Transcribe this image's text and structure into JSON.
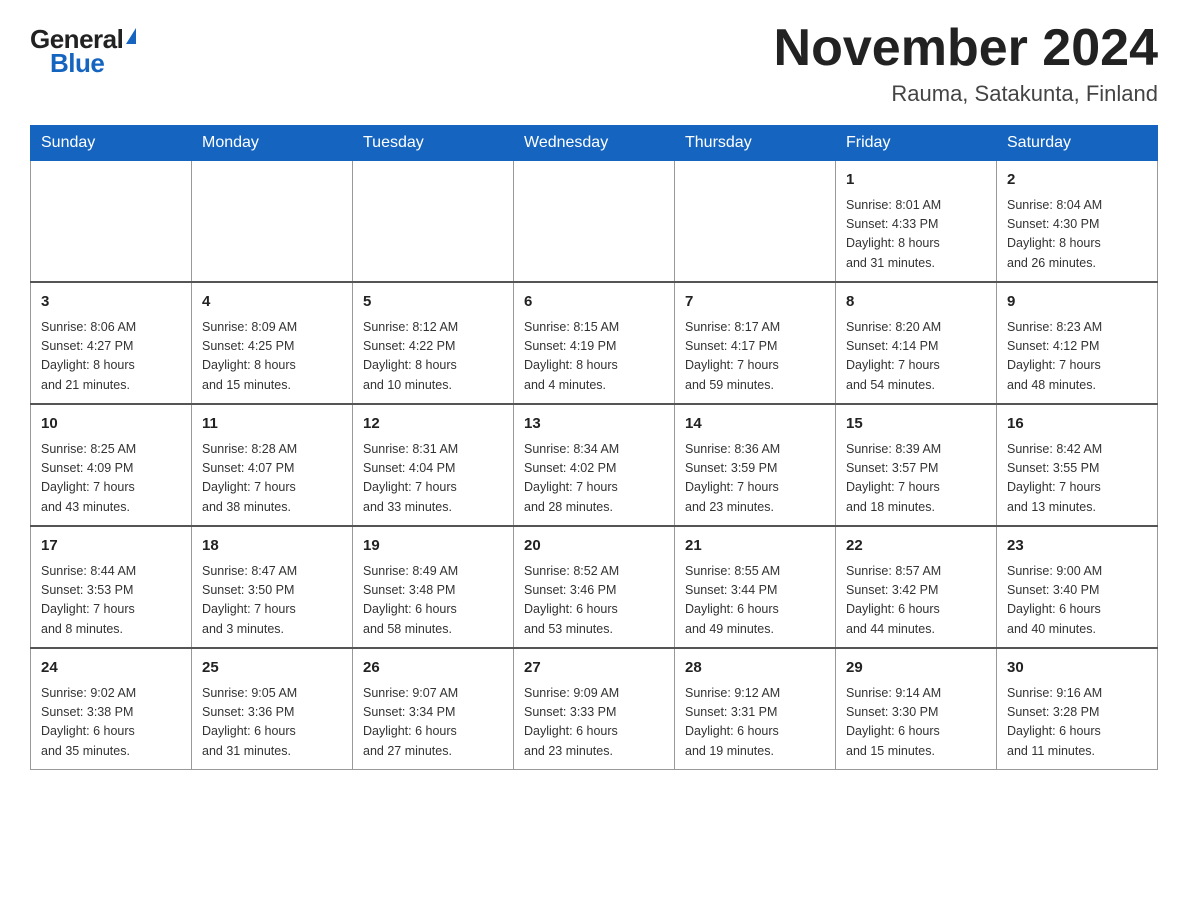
{
  "logo": {
    "general": "General",
    "blue": "Blue"
  },
  "title": "November 2024",
  "location": "Rauma, Satakunta, Finland",
  "days_of_week": [
    "Sunday",
    "Monday",
    "Tuesday",
    "Wednesday",
    "Thursday",
    "Friday",
    "Saturday"
  ],
  "weeks": [
    [
      {
        "day": "",
        "info": ""
      },
      {
        "day": "",
        "info": ""
      },
      {
        "day": "",
        "info": ""
      },
      {
        "day": "",
        "info": ""
      },
      {
        "day": "",
        "info": ""
      },
      {
        "day": "1",
        "info": "Sunrise: 8:01 AM\nSunset: 4:33 PM\nDaylight: 8 hours\nand 31 minutes."
      },
      {
        "day": "2",
        "info": "Sunrise: 8:04 AM\nSunset: 4:30 PM\nDaylight: 8 hours\nand 26 minutes."
      }
    ],
    [
      {
        "day": "3",
        "info": "Sunrise: 8:06 AM\nSunset: 4:27 PM\nDaylight: 8 hours\nand 21 minutes."
      },
      {
        "day": "4",
        "info": "Sunrise: 8:09 AM\nSunset: 4:25 PM\nDaylight: 8 hours\nand 15 minutes."
      },
      {
        "day": "5",
        "info": "Sunrise: 8:12 AM\nSunset: 4:22 PM\nDaylight: 8 hours\nand 10 minutes."
      },
      {
        "day": "6",
        "info": "Sunrise: 8:15 AM\nSunset: 4:19 PM\nDaylight: 8 hours\nand 4 minutes."
      },
      {
        "day": "7",
        "info": "Sunrise: 8:17 AM\nSunset: 4:17 PM\nDaylight: 7 hours\nand 59 minutes."
      },
      {
        "day": "8",
        "info": "Sunrise: 8:20 AM\nSunset: 4:14 PM\nDaylight: 7 hours\nand 54 minutes."
      },
      {
        "day": "9",
        "info": "Sunrise: 8:23 AM\nSunset: 4:12 PM\nDaylight: 7 hours\nand 48 minutes."
      }
    ],
    [
      {
        "day": "10",
        "info": "Sunrise: 8:25 AM\nSunset: 4:09 PM\nDaylight: 7 hours\nand 43 minutes."
      },
      {
        "day": "11",
        "info": "Sunrise: 8:28 AM\nSunset: 4:07 PM\nDaylight: 7 hours\nand 38 minutes."
      },
      {
        "day": "12",
        "info": "Sunrise: 8:31 AM\nSunset: 4:04 PM\nDaylight: 7 hours\nand 33 minutes."
      },
      {
        "day": "13",
        "info": "Sunrise: 8:34 AM\nSunset: 4:02 PM\nDaylight: 7 hours\nand 28 minutes."
      },
      {
        "day": "14",
        "info": "Sunrise: 8:36 AM\nSunset: 3:59 PM\nDaylight: 7 hours\nand 23 minutes."
      },
      {
        "day": "15",
        "info": "Sunrise: 8:39 AM\nSunset: 3:57 PM\nDaylight: 7 hours\nand 18 minutes."
      },
      {
        "day": "16",
        "info": "Sunrise: 8:42 AM\nSunset: 3:55 PM\nDaylight: 7 hours\nand 13 minutes."
      }
    ],
    [
      {
        "day": "17",
        "info": "Sunrise: 8:44 AM\nSunset: 3:53 PM\nDaylight: 7 hours\nand 8 minutes."
      },
      {
        "day": "18",
        "info": "Sunrise: 8:47 AM\nSunset: 3:50 PM\nDaylight: 7 hours\nand 3 minutes."
      },
      {
        "day": "19",
        "info": "Sunrise: 8:49 AM\nSunset: 3:48 PM\nDaylight: 6 hours\nand 58 minutes."
      },
      {
        "day": "20",
        "info": "Sunrise: 8:52 AM\nSunset: 3:46 PM\nDaylight: 6 hours\nand 53 minutes."
      },
      {
        "day": "21",
        "info": "Sunrise: 8:55 AM\nSunset: 3:44 PM\nDaylight: 6 hours\nand 49 minutes."
      },
      {
        "day": "22",
        "info": "Sunrise: 8:57 AM\nSunset: 3:42 PM\nDaylight: 6 hours\nand 44 minutes."
      },
      {
        "day": "23",
        "info": "Sunrise: 9:00 AM\nSunset: 3:40 PM\nDaylight: 6 hours\nand 40 minutes."
      }
    ],
    [
      {
        "day": "24",
        "info": "Sunrise: 9:02 AM\nSunset: 3:38 PM\nDaylight: 6 hours\nand 35 minutes."
      },
      {
        "day": "25",
        "info": "Sunrise: 9:05 AM\nSunset: 3:36 PM\nDaylight: 6 hours\nand 31 minutes."
      },
      {
        "day": "26",
        "info": "Sunrise: 9:07 AM\nSunset: 3:34 PM\nDaylight: 6 hours\nand 27 minutes."
      },
      {
        "day": "27",
        "info": "Sunrise: 9:09 AM\nSunset: 3:33 PM\nDaylight: 6 hours\nand 23 minutes."
      },
      {
        "day": "28",
        "info": "Sunrise: 9:12 AM\nSunset: 3:31 PM\nDaylight: 6 hours\nand 19 minutes."
      },
      {
        "day": "29",
        "info": "Sunrise: 9:14 AM\nSunset: 3:30 PM\nDaylight: 6 hours\nand 15 minutes."
      },
      {
        "day": "30",
        "info": "Sunrise: 9:16 AM\nSunset: 3:28 PM\nDaylight: 6 hours\nand 11 minutes."
      }
    ]
  ]
}
